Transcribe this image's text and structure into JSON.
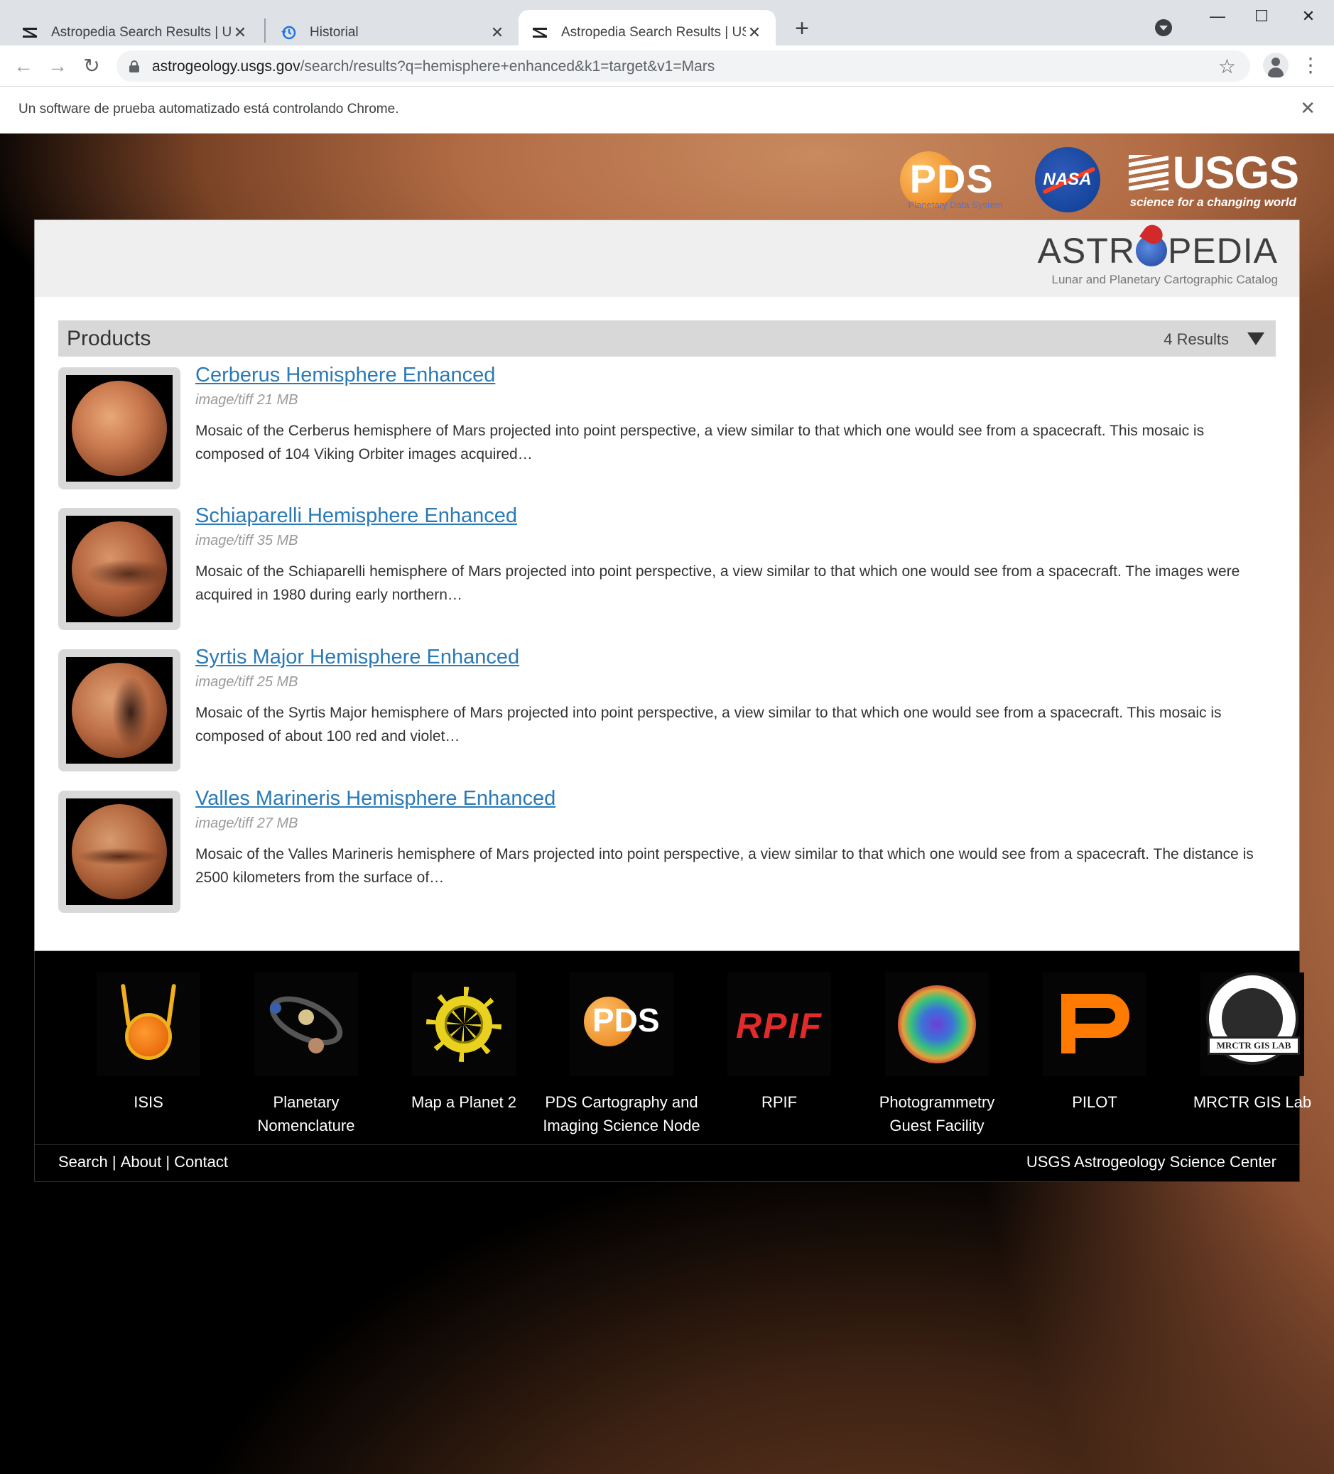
{
  "browser": {
    "tabs": [
      {
        "title": "Astropedia Search Results | USGS",
        "active": false,
        "icon": "usgs-favicon"
      },
      {
        "title": "Historial",
        "active": false,
        "icon": "history-icon"
      },
      {
        "title": "Astropedia Search Results | USGS",
        "active": true,
        "icon": "usgs-favicon"
      }
    ],
    "new_tab": "+",
    "url_host": "astrogeology.usgs.gov",
    "url_path": "/search/results?q=hemisphere+enhanced&k1=target&v1=Mars",
    "infobar_text": "Un software de prueba automatizado está controlando Chrome.",
    "window_controls": {
      "minimize": "—",
      "maximize": "☐",
      "close": "✕"
    }
  },
  "header": {
    "logos": [
      "PDS",
      "NASA",
      "USGS"
    ],
    "pds_sub": "Planetary Data System",
    "usgs_tagline": "science for a changing world",
    "astropedia_left": "ASTR",
    "astropedia_right": "PEDIA",
    "catalog_subtitle": "Lunar and Planetary Cartographic Catalog"
  },
  "products": {
    "title": "Products",
    "count": "4 Results",
    "items": [
      {
        "title": "Cerberus Hemisphere Enhanced",
        "meta": "image/tiff 21 MB",
        "description": "Mosaic of the Cerberus hemisphere of Mars projected into point perspective, a view similar to that which one would see from a spacecraft. This mosaic is composed of 104 Viking Orbiter images acquired…"
      },
      {
        "title": "Schiaparelli Hemisphere Enhanced",
        "meta": "image/tiff 35 MB",
        "description": "Mosaic of the Schiaparelli hemisphere of Mars projected into point perspective, a view similar to that which one would see from a spacecraft. The images were acquired in 1980 during early northern…"
      },
      {
        "title": "Syrtis Major Hemisphere Enhanced",
        "meta": "image/tiff 25 MB",
        "description": "Mosaic of the Syrtis Major hemisphere of Mars projected into point perspective, a view similar to that which one would see from a spacecraft. This mosaic is composed of about 100 red and violet…"
      },
      {
        "title": "Valles Marineris Hemisphere Enhanced",
        "meta": "image/tiff 27 MB",
        "description": "Mosaic of the Valles Marineris hemisphere of Mars projected into point perspective, a view similar to that which one would see from a spacecraft. The distance is 2500 kilometers from the surface of…"
      }
    ]
  },
  "footer": {
    "tools": [
      {
        "label": "ISIS"
      },
      {
        "label": "Planetary Nomenclature"
      },
      {
        "label": "Map a Planet 2"
      },
      {
        "label": "PDS Cartography and Imaging Science Node"
      },
      {
        "label": "RPIF"
      },
      {
        "label": "Photogrammetry Guest Facility"
      },
      {
        "label": "PILOT"
      },
      {
        "label": "MRCTR GIS Lab"
      }
    ],
    "logo_text": {
      "pds": "PDS",
      "rpif": "RPIF",
      "mrctr": "MRCTR GIS LAB"
    },
    "links": {
      "search": "Search",
      "about": "About",
      "contact": "Contact",
      "sep": "|"
    },
    "center_name": "USGS Astrogeology Science Center"
  },
  "colors": {
    "link": "#2a7ab7",
    "products_bar": "#d8d8d8",
    "brand_bar": "#efefef"
  }
}
